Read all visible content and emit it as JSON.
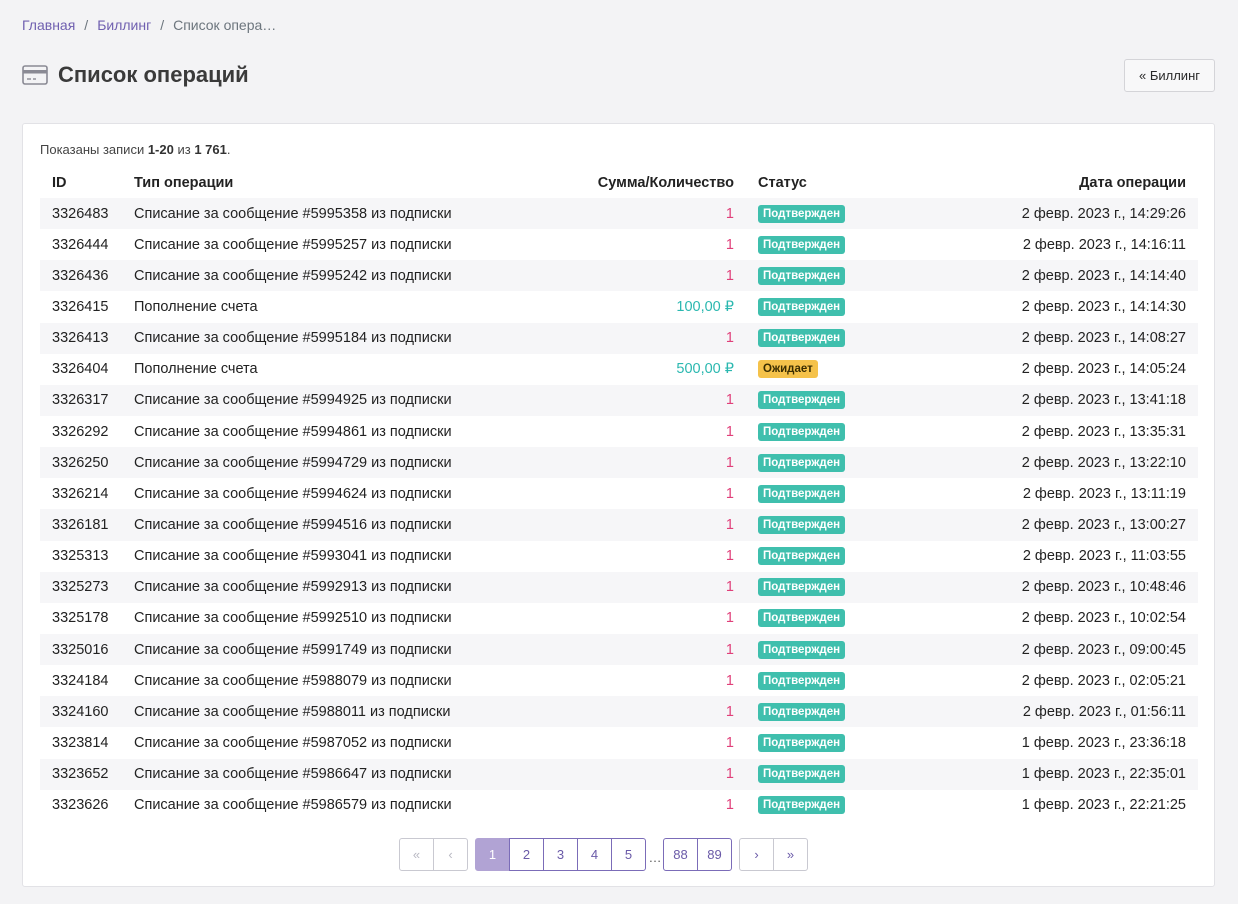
{
  "breadcrumb": {
    "home": "Главная",
    "billing": "Биллинг",
    "current": "Список опера…",
    "sep": "/"
  },
  "page": {
    "title": "Список операций",
    "back_button": "« Биллинг"
  },
  "summary": {
    "prefix": "Показаны записи ",
    "range": "1-20",
    "mid": " из ",
    "total": "1 761",
    "suffix": "."
  },
  "table": {
    "headers": [
      "ID",
      "Тип операции",
      "Сумма/Количество",
      "Статус",
      "Дата операции"
    ],
    "rows": [
      {
        "id": "3326483",
        "type": "Списание за сообщение #5995358 из подписки",
        "amount": "1",
        "kind": "neg",
        "status": "Подтвержден",
        "state": "ok",
        "date": "2 февр. 2023 г., 14:29:26"
      },
      {
        "id": "3326444",
        "type": "Списание за сообщение #5995257 из подписки",
        "amount": "1",
        "kind": "neg",
        "status": "Подтвержден",
        "state": "ok",
        "date": "2 февр. 2023 г., 14:16:11"
      },
      {
        "id": "3326436",
        "type": "Списание за сообщение #5995242 из подписки",
        "amount": "1",
        "kind": "neg",
        "status": "Подтвержден",
        "state": "ok",
        "date": "2 февр. 2023 г., 14:14:40"
      },
      {
        "id": "3326415",
        "type": "Пополнение счета",
        "amount": "100,00 ₽",
        "kind": "pos",
        "status": "Подтвержден",
        "state": "ok",
        "date": "2 февр. 2023 г., 14:14:30"
      },
      {
        "id": "3326413",
        "type": "Списание за сообщение #5995184 из подписки",
        "amount": "1",
        "kind": "neg",
        "status": "Подтвержден",
        "state": "ok",
        "date": "2 февр. 2023 г., 14:08:27"
      },
      {
        "id": "3326404",
        "type": "Пополнение счета",
        "amount": "500,00 ₽",
        "kind": "pos",
        "status": "Ожидает",
        "state": "wait",
        "date": "2 февр. 2023 г., 14:05:24"
      },
      {
        "id": "3326317",
        "type": "Списание за сообщение #5994925 из подписки",
        "amount": "1",
        "kind": "neg",
        "status": "Подтвержден",
        "state": "ok",
        "date": "2 февр. 2023 г., 13:41:18"
      },
      {
        "id": "3326292",
        "type": "Списание за сообщение #5994861 из подписки",
        "amount": "1",
        "kind": "neg",
        "status": "Подтвержден",
        "state": "ok",
        "date": "2 февр. 2023 г., 13:35:31"
      },
      {
        "id": "3326250",
        "type": "Списание за сообщение #5994729 из подписки",
        "amount": "1",
        "kind": "neg",
        "status": "Подтвержден",
        "state": "ok",
        "date": "2 февр. 2023 г., 13:22:10"
      },
      {
        "id": "3326214",
        "type": "Списание за сообщение #5994624 из подписки",
        "amount": "1",
        "kind": "neg",
        "status": "Подтвержден",
        "state": "ok",
        "date": "2 февр. 2023 г., 13:11:19"
      },
      {
        "id": "3326181",
        "type": "Списание за сообщение #5994516 из подписки",
        "amount": "1",
        "kind": "neg",
        "status": "Подтвержден",
        "state": "ok",
        "date": "2 февр. 2023 г., 13:00:27"
      },
      {
        "id": "3325313",
        "type": "Списание за сообщение #5993041 из подписки",
        "amount": "1",
        "kind": "neg",
        "status": "Подтвержден",
        "state": "ok",
        "date": "2 февр. 2023 г., 11:03:55"
      },
      {
        "id": "3325273",
        "type": "Списание за сообщение #5992913 из подписки",
        "amount": "1",
        "kind": "neg",
        "status": "Подтвержден",
        "state": "ok",
        "date": "2 февр. 2023 г., 10:48:46"
      },
      {
        "id": "3325178",
        "type": "Списание за сообщение #5992510 из подписки",
        "amount": "1",
        "kind": "neg",
        "status": "Подтвержден",
        "state": "ok",
        "date": "2 февр. 2023 г., 10:02:54"
      },
      {
        "id": "3325016",
        "type": "Списание за сообщение #5991749 из подписки",
        "amount": "1",
        "kind": "neg",
        "status": "Подтвержден",
        "state": "ok",
        "date": "2 февр. 2023 г., 09:00:45"
      },
      {
        "id": "3324184",
        "type": "Списание за сообщение #5988079 из подписки",
        "amount": "1",
        "kind": "neg",
        "status": "Подтвержден",
        "state": "ok",
        "date": "2 февр. 2023 г., 02:05:21"
      },
      {
        "id": "3324160",
        "type": "Списание за сообщение #5988011 из подписки",
        "amount": "1",
        "kind": "neg",
        "status": "Подтвержден",
        "state": "ok",
        "date": "2 февр. 2023 г., 01:56:11"
      },
      {
        "id": "3323814",
        "type": "Списание за сообщение #5987052 из подписки",
        "amount": "1",
        "kind": "neg",
        "status": "Подтвержден",
        "state": "ok",
        "date": "1 февр. 2023 г., 23:36:18"
      },
      {
        "id": "3323652",
        "type": "Списание за сообщение #5986647 из подписки",
        "amount": "1",
        "kind": "neg",
        "status": "Подтвержден",
        "state": "ok",
        "date": "1 февр. 2023 г., 22:35:01"
      },
      {
        "id": "3323626",
        "type": "Списание за сообщение #5986579 из подписки",
        "amount": "1",
        "kind": "neg",
        "status": "Подтвержден",
        "state": "ok",
        "date": "1 февр. 2023 г., 22:21:25"
      }
    ]
  },
  "pagination": {
    "first": "«",
    "prev": "‹",
    "pages": [
      "1",
      "2",
      "3",
      "4",
      "5"
    ],
    "ellipsis": "…",
    "tail_pages": [
      "88",
      "89"
    ],
    "next": "›",
    "last": "»",
    "current": "1"
  },
  "colors": {
    "accent": "#7060b0",
    "confirmed": "#3fbfad",
    "pending": "#f5c24a",
    "debit": "#e0407a",
    "credit": "#2bb8b0"
  }
}
